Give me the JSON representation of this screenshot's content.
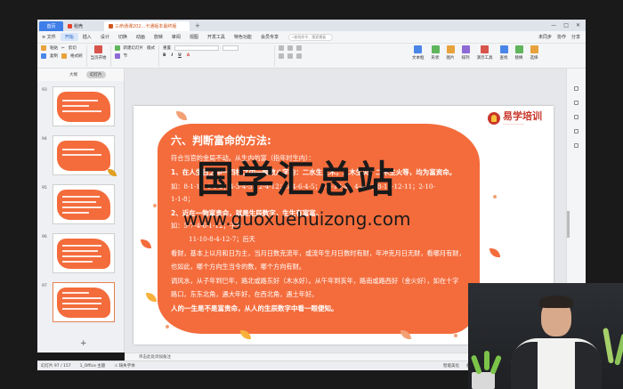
{
  "titlebar": {
    "tabs": [
      {
        "label": "首页",
        "color": "#3f7ee8"
      },
      {
        "label": "稻壳",
        "color": "#e8432d"
      },
      {
        "label": "三命通课202...卡通版本最终版",
        "color": "#d0561d"
      }
    ],
    "add": "+",
    "controls": [
      "—",
      "□",
      "✕"
    ]
  },
  "menubar": {
    "file": "≡ 文件",
    "items": [
      "开始",
      "插入",
      "设计",
      "切换",
      "动画",
      "放映",
      "审阅",
      "视图",
      "开发工具",
      "特色功能",
      "会员专享"
    ],
    "active": "开始",
    "search_placeholder": "查找命令、搜索模板",
    "right": [
      "未同步",
      "协作",
      "分享"
    ]
  },
  "toolbar": {
    "group1": {
      "row1": [
        "粘贴",
        "剪切"
      ],
      "row2": [
        "复制",
        "格式刷"
      ]
    },
    "group2": {
      "row1": [
        "当页开始"
      ]
    },
    "group3": {
      "row1": [
        "新建幻灯片",
        "版式"
      ],
      "row2": [
        "节"
      ]
    },
    "group4": {
      "row1": [
        "重置"
      ]
    },
    "right": [
      "文本框",
      "形状",
      "图片",
      "排列",
      "演示工具",
      "查找",
      "替换",
      "选择"
    ],
    "icon_colors": [
      "#e8a23c",
      "#4a86e8",
      "#5fb55c",
      "#d8544b",
      "#8d6ad6"
    ]
  },
  "panel": {
    "tabs": [
      "大纲",
      "幻灯片"
    ],
    "active": "幻灯片"
  },
  "thumbs": [
    {
      "num": "93"
    },
    {
      "num": "94"
    },
    {
      "num": "95"
    },
    {
      "num": "96"
    },
    {
      "num": "97"
    }
  ],
  "slide": {
    "logo_text": "易学培训",
    "heading": "六、判断富命的方法:",
    "lines": [
      "符合当官的金局不动。从生内的富（指年时生内）：",
      "1、在人生日之中一四柱之中一顺数八字的：二水生三木，二木生火，二木生火等，均为富资命。",
      "如：8-1-1；4-1-2；4-3-4-5；2-4-12；5-4-6-4-5；2-6-10-4；4-4-8；8-10-12-11；2-10-",
      "1-1-8；",
      "2、近在一物富贵命，就是生辰数字，生生有富富。",
      "如：5-7-4-6-1-12；子午",
      "11-10-8-4-12-7；后天",
      "看财，基本上以月和日为主，当月日数克流年，或流年生月日数时有财，年冲克月日无财，看哪月有财，",
      "也如此，哪个方向生当令的数，哪个方向有财。",
      "调风水，从子年到巳年，路北或路东好（木水好）。从午年到亥年，路南或路西好（金火好），如在十字",
      "路口，东东北角，遇大年好，在西北角，遇土年好。",
      "人的一生是不是富贵命，从人的生辰数字中看一眼便知。"
    ],
    "watermark_cn": "国学汇总站",
    "watermark_url": "www.guoxuehuizong.com",
    "accent": "#f46c3c"
  },
  "notes": "单击此处添加备注",
  "status": {
    "slide_pos": "幻灯片 97 / 157",
    "theme": "1_Office 主题",
    "missing_font": "缺失字体",
    "smart": "智能美化",
    "notes_btn": "备注",
    "comment": "批注",
    "zoom": "48%"
  }
}
